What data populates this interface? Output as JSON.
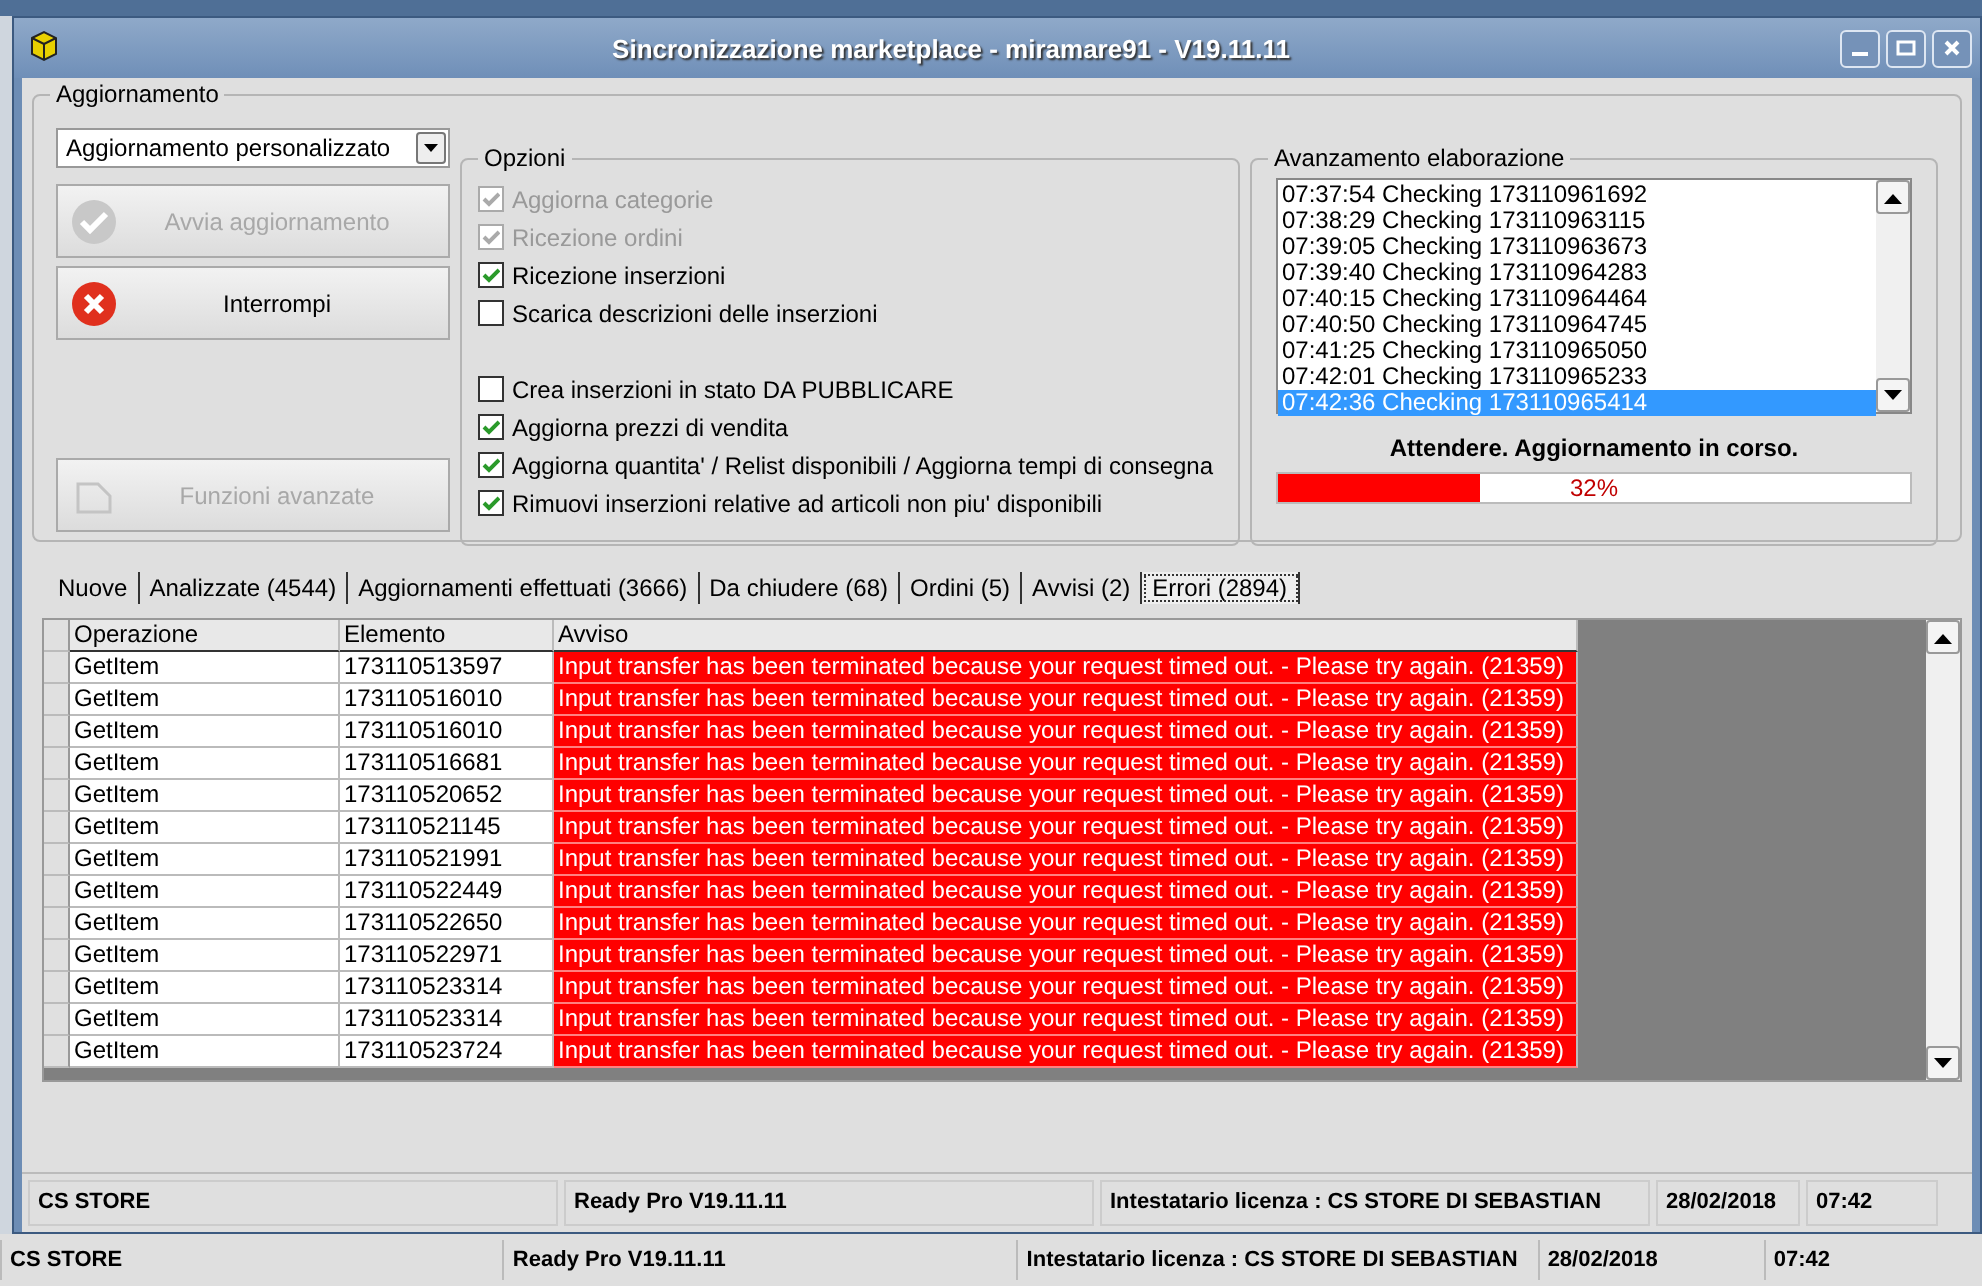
{
  "window": {
    "title": "Sincronizzazione marketplace - miramare91 - V19.11.11"
  },
  "update_group": {
    "title": "Aggiornamento",
    "mode": "Aggiornamento personalizzato",
    "buttons": [
      {
        "label": "Avvia aggiornamento",
        "kind": "check",
        "disabled": true
      },
      {
        "label": "Interrompi",
        "kind": "stop",
        "disabled": false
      },
      {
        "label": "Funzioni avanzate",
        "kind": "tools",
        "disabled": true
      }
    ]
  },
  "options": {
    "title": "Opzioni",
    "sections": [
      {
        "items": [
          {
            "label": "Aggiorna categorie",
            "checked": true,
            "disabled": true
          },
          {
            "label": "Ricezione ordini",
            "checked": true,
            "disabled": true
          },
          {
            "label": "Ricezione inserzioni",
            "checked": true,
            "disabled": false
          },
          {
            "label": "Scarica descrizioni delle inserzioni",
            "checked": false,
            "disabled": false
          }
        ]
      },
      {
        "items": [
          {
            "label": "Crea inserzioni in stato DA PUBBLICARE",
            "checked": false,
            "disabled": false
          },
          {
            "label": "Aggiorna prezzi di vendita",
            "checked": true,
            "disabled": false
          },
          {
            "label": "Aggiorna quantita' / Relist disponibili / Aggiorna tempi di consegna",
            "checked": true,
            "disabled": false
          },
          {
            "label": "Rimuovi inserzioni relative ad articoli non piu' disponibili",
            "checked": true,
            "disabled": false
          }
        ]
      }
    ]
  },
  "progress": {
    "title": "Avanzamento elaborazione",
    "log": [
      {
        "time": "07:37:54",
        "text": "Checking 173110961692",
        "selected": false
      },
      {
        "time": "07:38:29",
        "text": "Checking 173110963115",
        "selected": false
      },
      {
        "time": "07:39:05",
        "text": "Checking 173110963673",
        "selected": false
      },
      {
        "time": "07:39:40",
        "text": "Checking 173110964283",
        "selected": false
      },
      {
        "time": "07:40:15",
        "text": "Checking 173110964464",
        "selected": false
      },
      {
        "time": "07:40:50",
        "text": "Checking 173110964745",
        "selected": false
      },
      {
        "time": "07:41:25",
        "text": "Checking 173110965050",
        "selected": false
      },
      {
        "time": "07:42:01",
        "text": "Checking 173110965233",
        "selected": false
      },
      {
        "time": "07:42:36",
        "text": "Checking 173110965414",
        "selected": true
      }
    ],
    "status": "Attendere. Aggiornamento in corso.",
    "level": 0.32,
    "reading": "32%"
  },
  "tabs": [
    {
      "label": "Nuove",
      "selected": false
    },
    {
      "label": "Analizzate (4544)",
      "selected": false
    },
    {
      "label": "Aggiornamenti effettuati (3666)",
      "selected": false
    },
    {
      "label": "Da chiudere (68)",
      "selected": false
    },
    {
      "label": "Ordini (5)",
      "selected": false
    },
    {
      "label": "Avvisi (2)",
      "selected": false
    },
    {
      "label": "Errori (2894)",
      "selected": true
    }
  ],
  "table": {
    "columns": [
      "Operazione",
      "Elemento",
      "Avviso"
    ],
    "rows": [
      [
        "GetItem",
        "173110513597",
        "Input transfer has been terminated because your request timed out. - Please try again. (21359)"
      ],
      [
        "GetItem",
        "173110516010",
        "Input transfer has been terminated because your request timed out. - Please try again. (21359)"
      ],
      [
        "GetItem",
        "173110516010",
        "Input transfer has been terminated because your request timed out. - Please try again. (21359)"
      ],
      [
        "GetItem",
        "173110516681",
        "Input transfer has been terminated because your request timed out. - Please try again. (21359)"
      ],
      [
        "GetItem",
        "173110520652",
        "Input transfer has been terminated because your request timed out. - Please try again. (21359)"
      ],
      [
        "GetItem",
        "173110521145",
        "Input transfer has been terminated because your request timed out. - Please try again. (21359)"
      ],
      [
        "GetItem",
        "173110521991",
        "Input transfer has been terminated because your request timed out. - Please try again. (21359)"
      ],
      [
        "GetItem",
        "173110522449",
        "Input transfer has been terminated because your request timed out. - Please try again. (21359)"
      ],
      [
        "GetItem",
        "173110522650",
        "Input transfer has been terminated because your request timed out. - Please try again. (21359)"
      ],
      [
        "GetItem",
        "173110522971",
        "Input transfer has been terminated because your request timed out. - Please try again. (21359)"
      ],
      [
        "GetItem",
        "173110523314",
        "Input transfer has been terminated because your request timed out. - Please try again. (21359)"
      ],
      [
        "GetItem",
        "173110523314",
        "Input transfer has been terminated because your request timed out. - Please try again. (21359)"
      ],
      [
        "GetItem",
        "173110523724",
        "Input transfer has been terminated because your request timed out. - Please try again. (21359)"
      ]
    ]
  },
  "window_status_bar": [
    "CS STORE",
    "Ready Pro V19.11.11",
    "Intestatario licenza : CS STORE DI SEBASTIAN",
    "28/02/2018",
    "07:42"
  ],
  "app_status_bar": [
    "CS STORE",
    "Ready Pro V19.11.11",
    "Intestatario licenza : CS STORE DI SEBASTIAN",
    "28/02/2018",
    "07:42"
  ]
}
